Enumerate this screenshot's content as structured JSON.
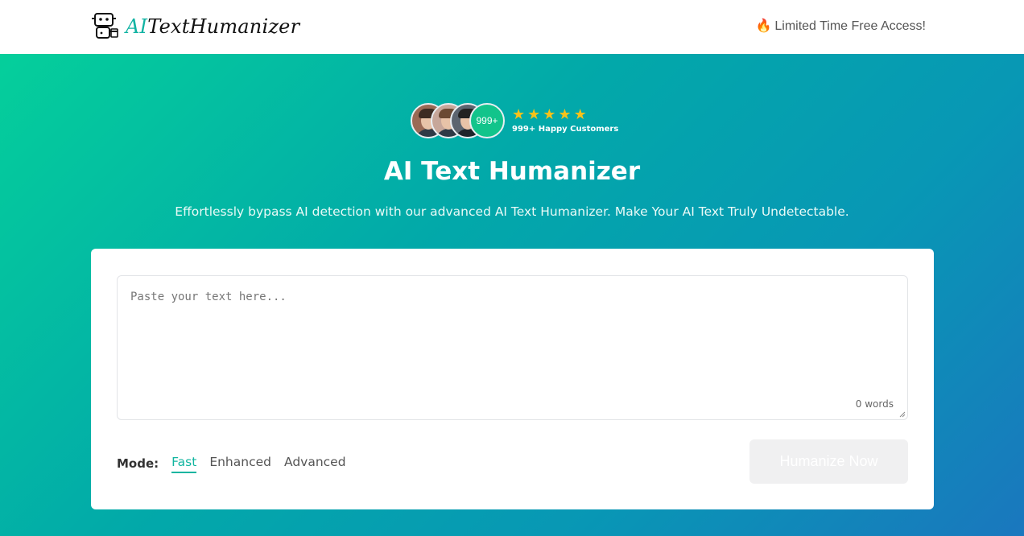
{
  "header": {
    "logo_ai": "AI",
    "logo_rest": "TextHumanizer",
    "promo_icon": "fire-icon",
    "promo_text": "Limited Time Free Access!"
  },
  "social_proof": {
    "count_badge": "999+",
    "rating": 5,
    "caption": "999+ Happy Customers"
  },
  "hero": {
    "title": "AI Text Humanizer",
    "subtitle": "Effortlessly bypass AI detection with our advanced AI Text Humanizer. Make Your AI Text Truly Undetectable."
  },
  "editor": {
    "placeholder": "Paste your text here...",
    "value": "",
    "word_count": "0 words"
  },
  "modes": {
    "label": "Mode:",
    "items": [
      {
        "label": "Fast",
        "active": true
      },
      {
        "label": "Enhanced",
        "active": false
      },
      {
        "label": "Advanced",
        "active": false
      }
    ]
  },
  "actions": {
    "humanize_label": "Humanize Now"
  },
  "colors": {
    "accent": "#12b5a0",
    "gradient_start": "#05cf9b",
    "gradient_end": "#1a77be",
    "star": "#f7c21a"
  }
}
